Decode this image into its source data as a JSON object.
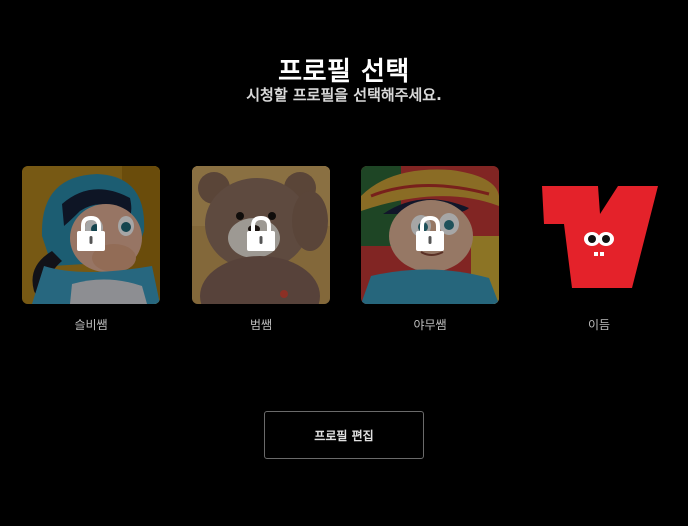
{
  "header": {
    "title": "프로필 선택",
    "subtitle": "시청할 프로필을 선택해주세요."
  },
  "profiles": [
    {
      "name": "슬비쌤",
      "locked": true,
      "avatar": "girl-with-ponytail",
      "background_color": "#b7891f"
    },
    {
      "name": "범쌤",
      "locked": true,
      "avatar": "teddy-bear",
      "background_color": "#c9a05a"
    },
    {
      "name": "야무쌤",
      "locked": true,
      "avatar": "boy-with-straw-hat",
      "background_color": "#c63a36"
    },
    {
      "name": "이듬",
      "locked": false,
      "avatar": "red-v-logo-with-eyes",
      "background_color": "#000000"
    }
  ],
  "actions": {
    "edit_label": "프로필 편집"
  },
  "colors": {
    "background": "#000000",
    "logo_red": "#e4222a",
    "overlay_dim": "rgba(0,0,0,0.35)",
    "button_border": "#6a6a6a"
  },
  "icons": [
    "lock-icon",
    "red-v-logo"
  ]
}
